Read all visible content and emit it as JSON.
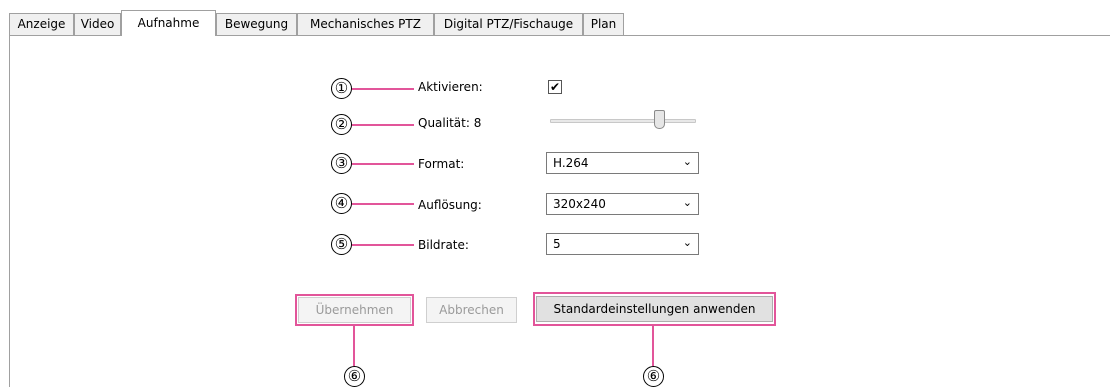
{
  "tabs": [
    "Anzeige",
    "Video",
    "Aufnahme",
    "Bewegung",
    "Mechanisches PTZ",
    "Digital PTZ/Fischauge",
    "Plan"
  ],
  "active_tab": "Aufnahme",
  "callouts": [
    "①",
    "②",
    "③",
    "④",
    "⑤",
    "⑥"
  ],
  "fields": {
    "enable_label": "Aktivieren:",
    "enable_checked": true,
    "check_glyph": "✔",
    "quality_label": "Qualität: 8",
    "quality_value": 8,
    "format_label": "Format:",
    "format_value": "H.264",
    "resolution_label": "Auflösung:",
    "resolution_value": "320x240",
    "framerate_label": "Bildrate:",
    "framerate_value": "5",
    "chevron": "⌄"
  },
  "buttons": {
    "apply": "Übernehmen",
    "cancel": "Abbrechen",
    "defaults": "Standardeinstellungen anwenden"
  },
  "colors": {
    "callout_line": "#e2559a"
  }
}
